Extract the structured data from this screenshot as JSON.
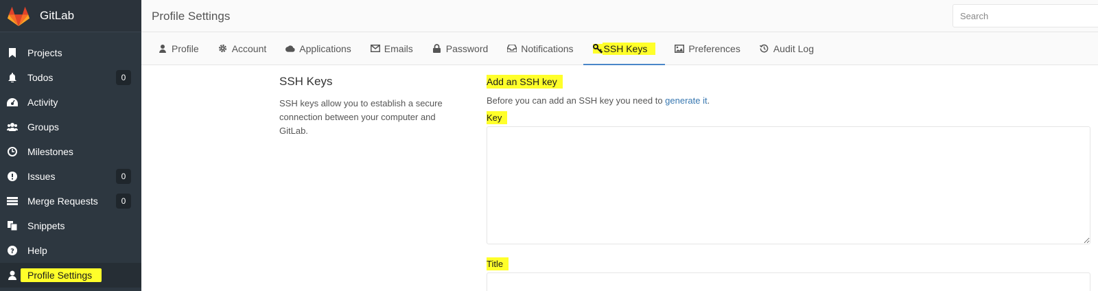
{
  "sidebar": {
    "brand_name": "GitLab",
    "items": [
      {
        "label": "Projects",
        "icon": "bookmark-icon",
        "count": null
      },
      {
        "label": "Todos",
        "icon": "bell-icon",
        "count": "0"
      },
      {
        "label": "Activity",
        "icon": "dashboard-icon",
        "count": null
      },
      {
        "label": "Groups",
        "icon": "users-icon",
        "count": null
      },
      {
        "label": "Milestones",
        "icon": "clock-icon",
        "count": null
      },
      {
        "label": "Issues",
        "icon": "exclamation-circle-icon",
        "count": "0"
      },
      {
        "label": "Merge Requests",
        "icon": "list-icon",
        "count": "0"
      },
      {
        "label": "Snippets",
        "icon": "clipboard-icon",
        "count": null
      },
      {
        "label": "Help",
        "icon": "question-circle-icon",
        "count": null
      },
      {
        "label": "Profile Settings",
        "icon": "user-icon",
        "count": null,
        "active": true
      }
    ]
  },
  "header": {
    "title": "Profile Settings",
    "search_placeholder": "Search"
  },
  "tabs": [
    {
      "label": "Profile",
      "icon": "user-icon"
    },
    {
      "label": "Account",
      "icon": "gear-icon"
    },
    {
      "label": "Applications",
      "icon": "cloud-icon"
    },
    {
      "label": "Emails",
      "icon": "envelope-icon"
    },
    {
      "label": "Password",
      "icon": "lock-icon"
    },
    {
      "label": "Notifications",
      "icon": "inbox-icon"
    },
    {
      "label": "SSH Keys",
      "icon": "key-icon",
      "active": true
    },
    {
      "label": "Preferences",
      "icon": "image-icon"
    },
    {
      "label": "Audit Log",
      "icon": "history-icon"
    }
  ],
  "ssh": {
    "heading": "SSH Keys",
    "description": "SSH keys allow you to establish a secure connection between your computer and GitLab.",
    "add_title": "Add an SSH key",
    "before_text": "Before you can add an SSH key you need to ",
    "generate_link": "generate it",
    "after_text": ".",
    "key_label": "Key",
    "title_label": "Title"
  },
  "colors": {
    "sidebar_bg": "#2d3740",
    "highlight": "#ffff2a",
    "link": "#3777b0",
    "tab_active_underline": "#4a86c8"
  }
}
